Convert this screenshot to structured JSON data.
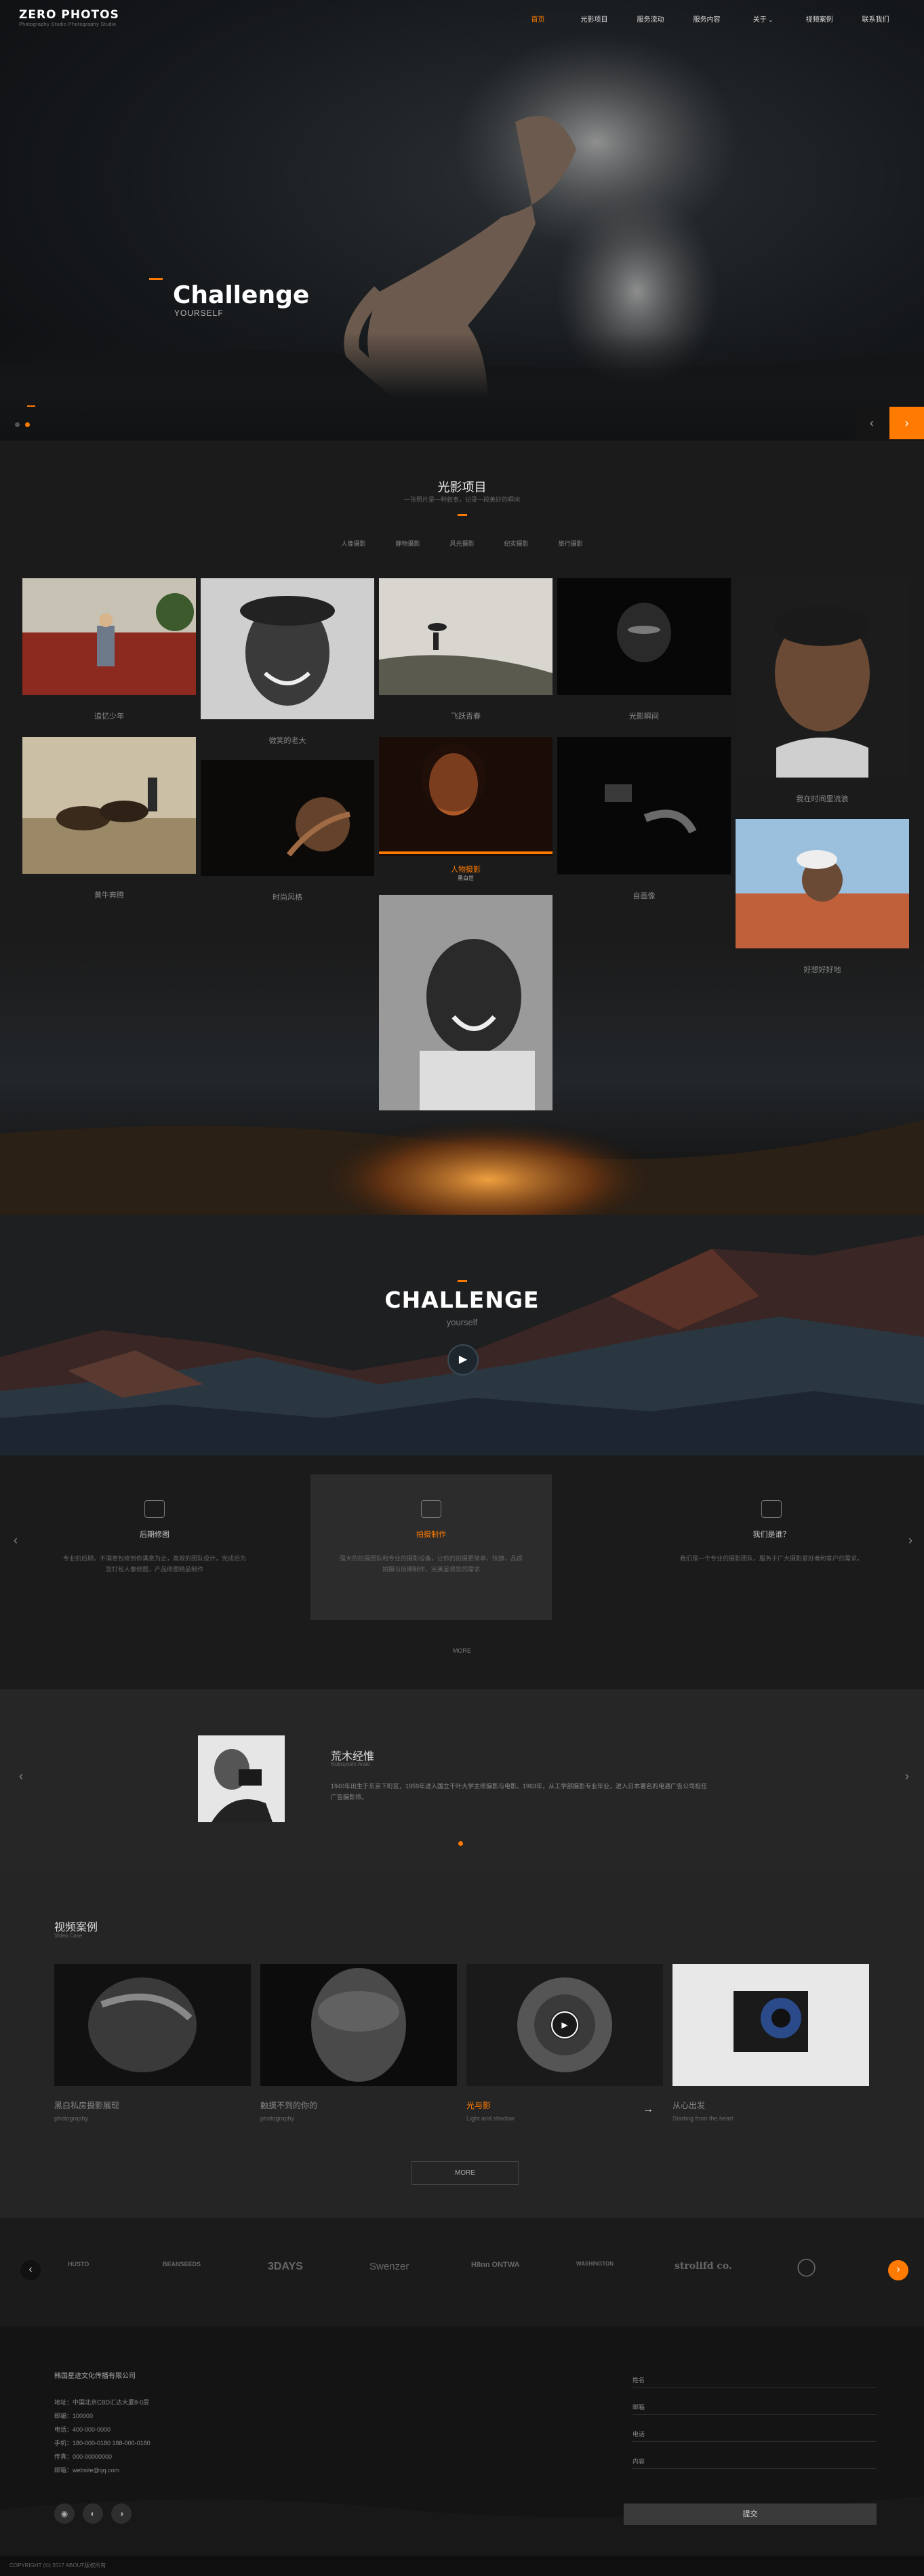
{
  "brand": {
    "logo": "ZERO PHOTOS",
    "tagline": "Photography Studio Photography Studio"
  },
  "nav": {
    "items": [
      "首页",
      "光影项目",
      "服务流动",
      "服务内容",
      "关于",
      "视频案例",
      "联系我们"
    ],
    "active": 0,
    "dropdown_item": 4
  },
  "hero": {
    "title": "Challenge",
    "subtitle": "YOURSELF",
    "prev": "‹",
    "next": "›"
  },
  "portfolio": {
    "title": "光影项目",
    "subtitle": "一张照片是一种叙事，记录一段美好的瞬间",
    "filters": [
      "人像摄影",
      "静物摄影",
      "风光摄影",
      "纪实摄影",
      "旅行摄影"
    ],
    "tiles": [
      {
        "caption": "追忆少年"
      },
      {
        "caption": "微笑的老大"
      },
      {
        "caption": "飞跃青春"
      },
      {
        "caption": "光影瞬间"
      },
      {
        "caption": "我在时间里流浪"
      },
      {
        "caption": "黄牛奔腾"
      },
      {
        "caption": "时尚风格"
      },
      {
        "caption": "人物摄影",
        "sub": "黑白世"
      },
      {
        "caption": "自画像"
      },
      {
        "caption": "好想好好地"
      },
      {
        "caption": ""
      }
    ]
  },
  "challenge": {
    "title": "CHALLENGE",
    "subtitle": "yourself",
    "play_icon": "play-icon"
  },
  "services": {
    "items": [
      {
        "icon": "camera-video-icon",
        "title": "后期修图",
        "text": "专业的后期，不满意包修到你满意为止，高效的团队设计，完成后为您打包人像修图，产品修图精品制作"
      },
      {
        "icon": "camera-icon",
        "title": "拍摄制作",
        "text": "强大的拍摄团队和专业的摄影设备，让你的拍摄更简单，快捷，品质拍摄与后期制作，完美呈现您的需求"
      },
      {
        "icon": "photo-icon",
        "title": "我们是谁？",
        "text": "我们是一个专业的摄影团队，服务于广大摄影爱好者和客户的需求。"
      }
    ],
    "more": "MORE"
  },
  "about": {
    "name": "荒木经惟",
    "name_en": "Nobuyoshi Araki",
    "text": "1940年出生于东京下町区，1959年进入国立千叶大学主修摄影与电影。1963年，从工学部摄影专业毕业，进入日本著名的电通广告公司担任广告摄影师。"
  },
  "videos": {
    "title": "视频案例",
    "subtitle": "Video Case",
    "items": [
      {
        "title": "黑白私房摄影展现",
        "sub": "photography"
      },
      {
        "title": "触摸不到的你的",
        "sub": "photography"
      },
      {
        "title": "光与影",
        "sub": "Light and shadow"
      },
      {
        "title": "从心出发",
        "sub": "Starting from the heart"
      }
    ],
    "more": "MORE"
  },
  "partners": {
    "logos": [
      "HUSTO",
      "BEANSEEDS",
      "3DAYS",
      "Swenzer",
      "H8nn ONTWA",
      "WASHINGTON",
      "strolifd co.",
      "◯"
    ],
    "prev": "‹",
    "next": "›"
  },
  "footer": {
    "company": "韩国星迹文化传播有限公司",
    "lines": [
      "地址：中国北京CBD汇达大厦8-0层",
      "邮编：100000",
      "电话：400-000-0000",
      "手机：180-000-0180 188-000-0180",
      "传真：000-00000000",
      "邮箱：website@qq.com"
    ],
    "form": [
      "姓名",
      "邮箱",
      "电话",
      "内容"
    ],
    "submit": "提交",
    "copyright": "COPYRIGHT (©) 2017 ABOUT版权所有"
  },
  "colors": {
    "accent": "#ff7a00",
    "background": "#1b1b1b"
  }
}
